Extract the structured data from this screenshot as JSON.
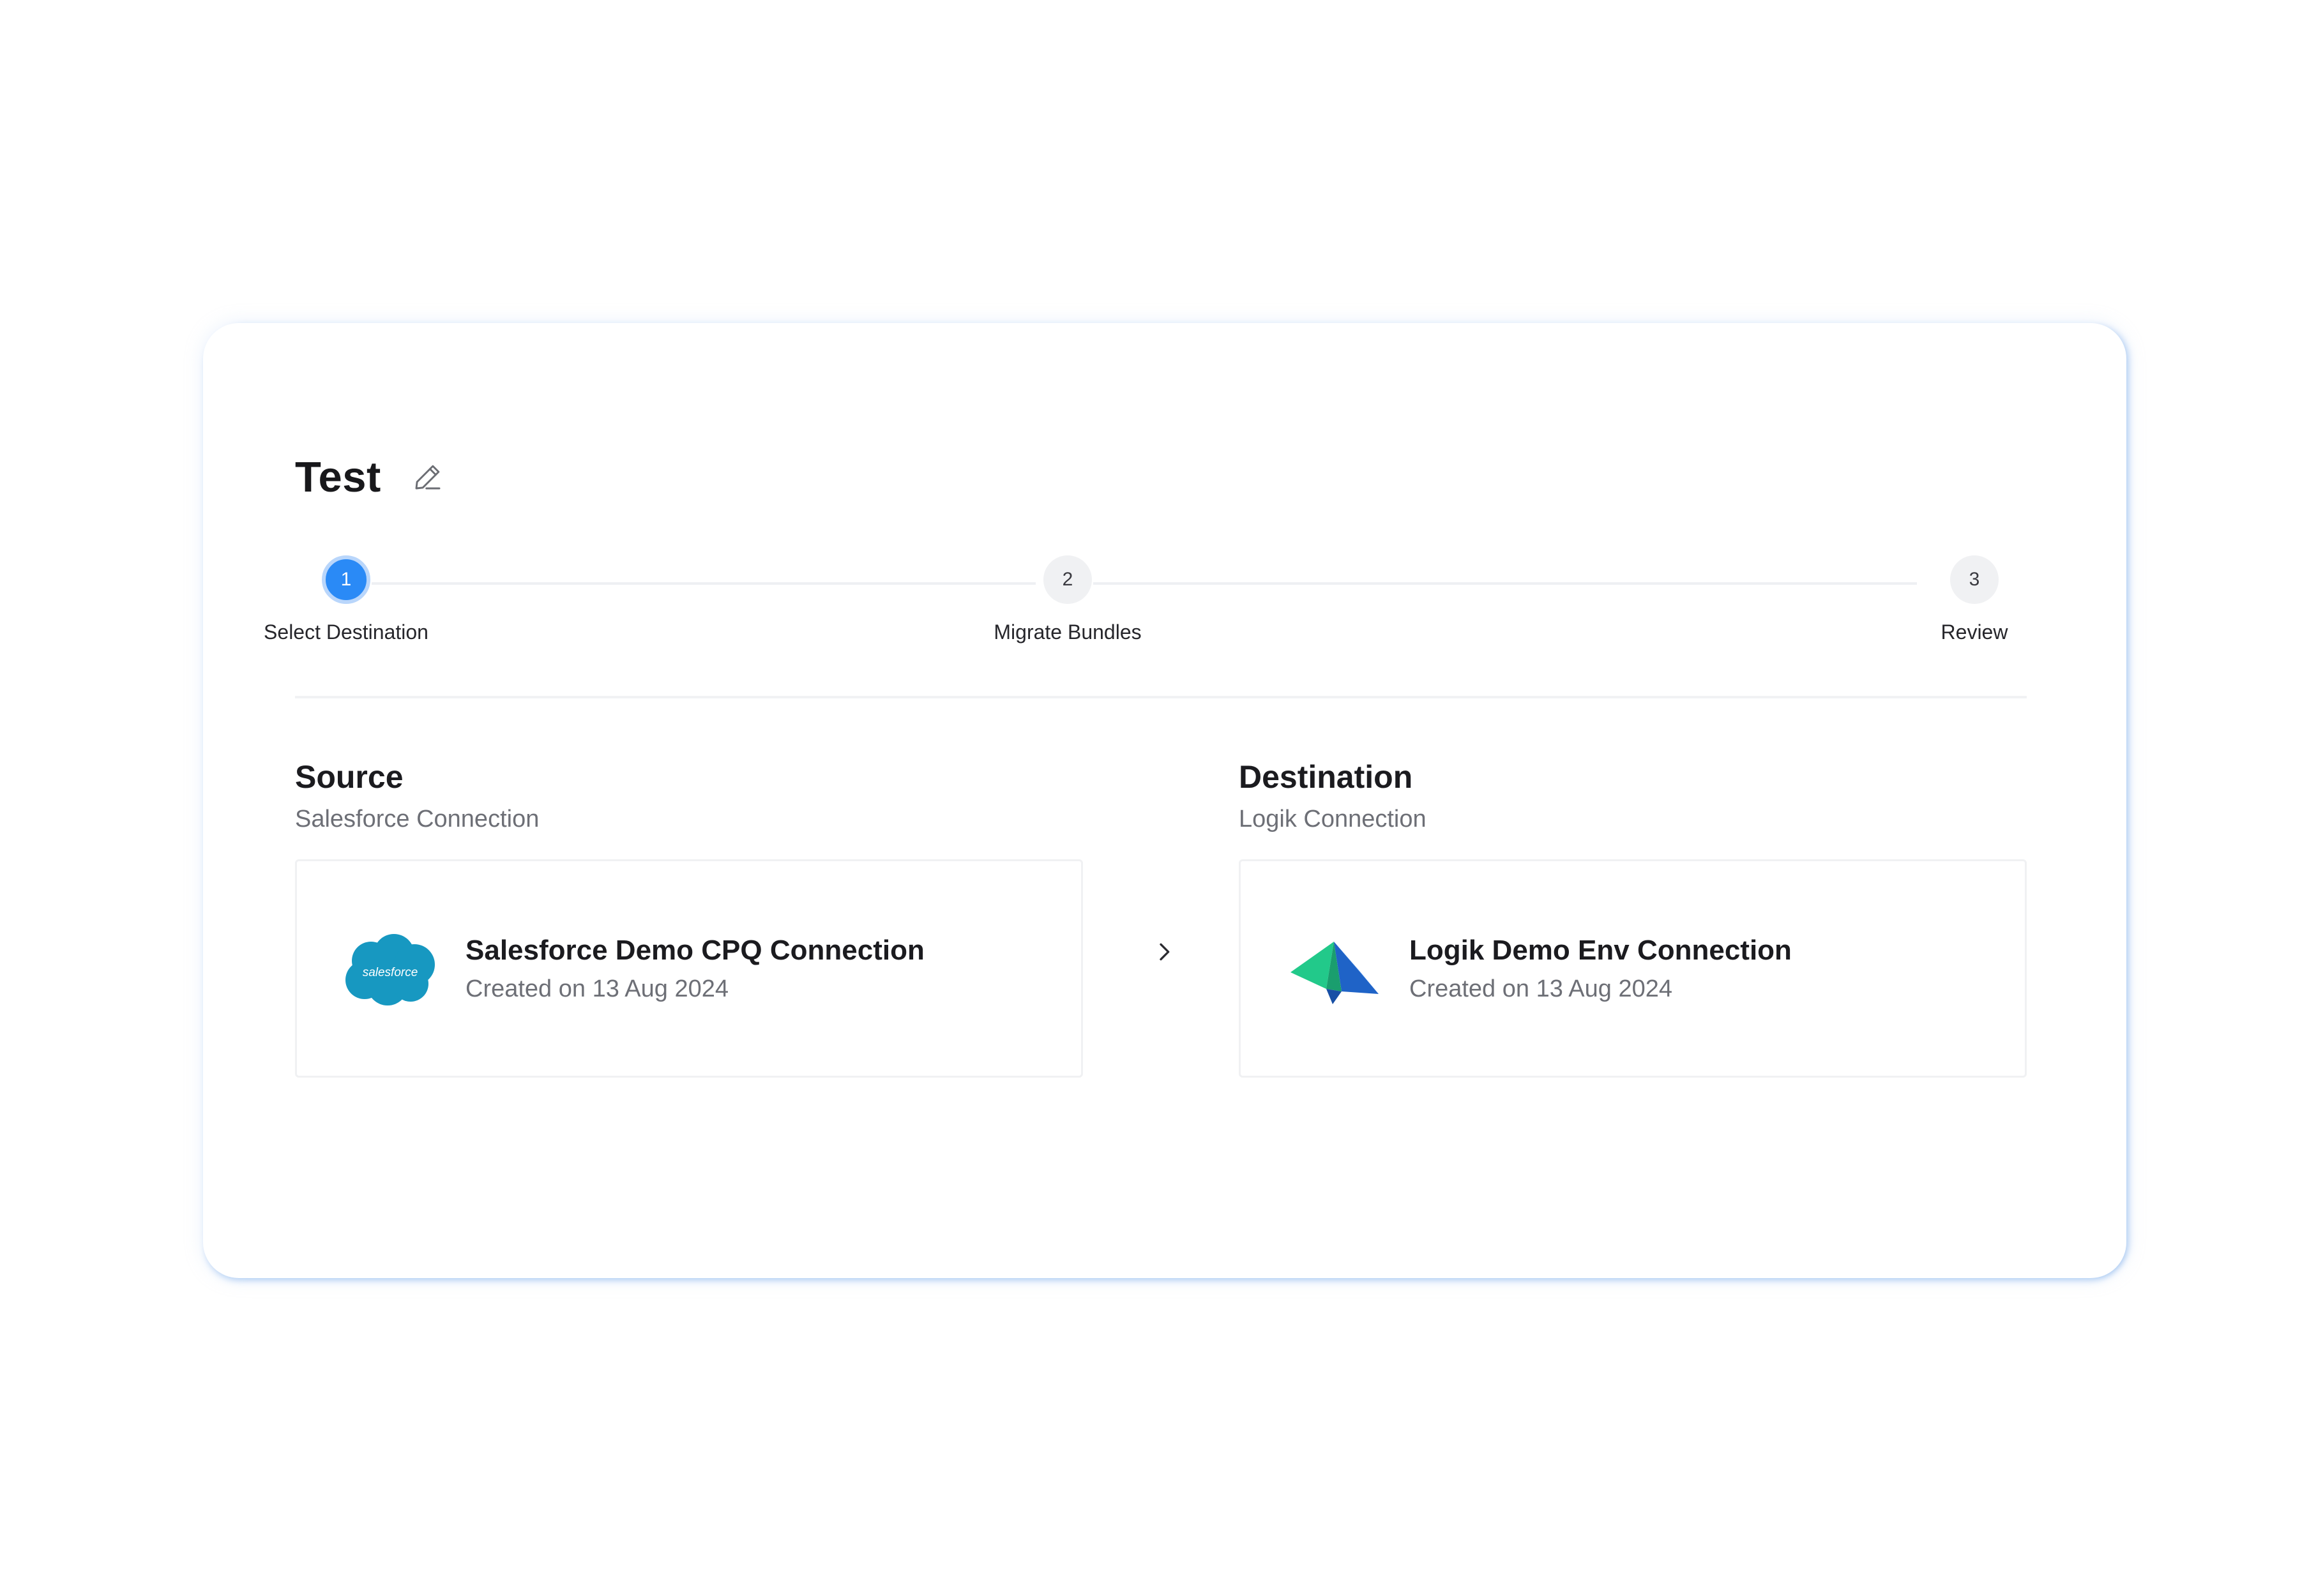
{
  "wizard": {
    "title": "Test",
    "steps": [
      {
        "number": "1",
        "label": "Select Destination",
        "state": "active"
      },
      {
        "number": "2",
        "label": "Migrate Bundles",
        "state": "inactive"
      },
      {
        "number": "3",
        "label": "Review",
        "state": "inactive"
      }
    ]
  },
  "source": {
    "title": "Source",
    "subtitle": "Salesforce Connection",
    "connection": {
      "name": "Salesforce Demo CPQ Connection",
      "created": "Created on 13 Aug 2024",
      "logo_text": "salesforce",
      "logo_color": "#1798c1"
    }
  },
  "destination": {
    "title": "Destination",
    "subtitle": "Logik Connection",
    "connection": {
      "name": "Logik Demo Env Connection",
      "created": "Created on 13 Aug 2024"
    }
  },
  "icons": {
    "edit": "pencil-icon",
    "arrow": "chevron-right-icon"
  },
  "colors": {
    "accent": "#2a8af6",
    "card_glow": "#78aaeb"
  }
}
